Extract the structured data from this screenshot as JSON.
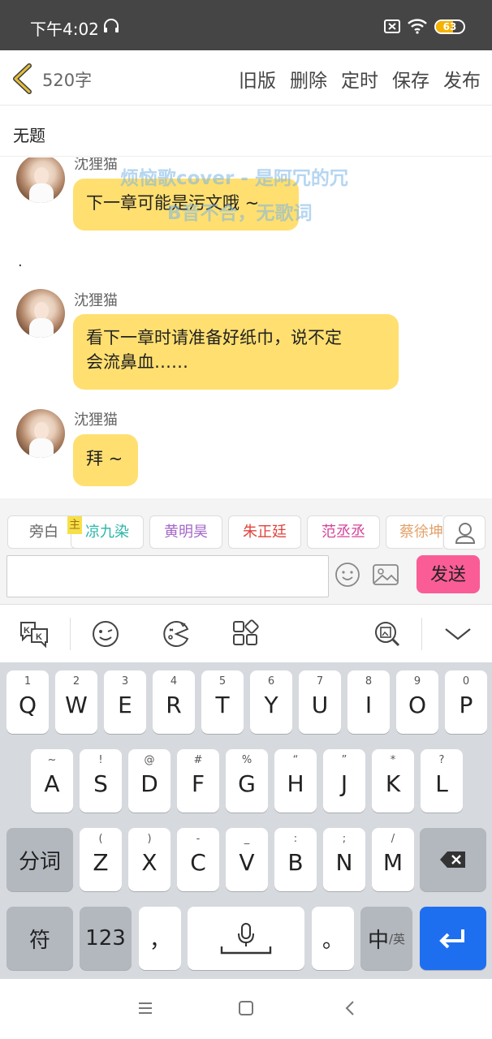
{
  "status_bar": {
    "time": "下午4:02",
    "battery": "63",
    "battery_level": 0.63,
    "icons": [
      "headset-icon",
      "sim-icon",
      "wifi-icon",
      "battery-icon"
    ]
  },
  "toolbar": {
    "word_count": "520字",
    "actions": [
      "旧版",
      "删除",
      "定时",
      "保存",
      "发布"
    ]
  },
  "title": "无题",
  "messages": [
    {
      "sender": "沈狸猫",
      "text": "下一章可能是污文哦 ~"
    },
    {
      "dot": "."
    },
    {
      "sender": "沈狸猫",
      "text_line1": "看下一章时请准备好纸巾，说不定",
      "text_line2": "会流鼻血……"
    },
    {
      "sender": "沈狸猫",
      "text": "拜 ~"
    }
  ],
  "watermark": {
    "line1": "烦恼歌cover - 是阿冗的冗",
    "line2": "B音不合，无歌词"
  },
  "roles": {
    "host_badge": "主",
    "chips": [
      {
        "name": "旁白",
        "color": "#666666"
      },
      {
        "name": "凉九染",
        "color": "#2bb5a8"
      },
      {
        "name": "黄明昊",
        "color": "#a468c8"
      },
      {
        "name": "朱正廷",
        "color": "#e0443e"
      },
      {
        "name": "范丞丞",
        "color": "#d2439a"
      },
      {
        "name": "蔡徐坤",
        "color": "#e3a26a"
      }
    ]
  },
  "input": {
    "value": "",
    "send_label": "发送"
  },
  "keyboard": {
    "row1": [
      {
        "sub": "1",
        "main": "Q"
      },
      {
        "sub": "2",
        "main": "W"
      },
      {
        "sub": "3",
        "main": "E"
      },
      {
        "sub": "4",
        "main": "R"
      },
      {
        "sub": "5",
        "main": "T"
      },
      {
        "sub": "6",
        "main": "Y"
      },
      {
        "sub": "7",
        "main": "U"
      },
      {
        "sub": "8",
        "main": "I"
      },
      {
        "sub": "9",
        "main": "O"
      },
      {
        "sub": "0",
        "main": "P"
      }
    ],
    "row2": [
      {
        "sub": "~",
        "main": "A"
      },
      {
        "sub": "!",
        "main": "S"
      },
      {
        "sub": "@",
        "main": "D"
      },
      {
        "sub": "#",
        "main": "F"
      },
      {
        "sub": "%",
        "main": "G"
      },
      {
        "sub": "“",
        "main": "H"
      },
      {
        "sub": "”",
        "main": "J"
      },
      {
        "sub": "*",
        "main": "K"
      },
      {
        "sub": "?",
        "main": "L"
      }
    ],
    "row3": [
      {
        "sub": "(",
        "main": "Z"
      },
      {
        "sub": ")",
        "main": "X"
      },
      {
        "sub": "-",
        "main": "C"
      },
      {
        "sub": "_",
        "main": "V"
      },
      {
        "sub": ":",
        "main": "B"
      },
      {
        "sub": ";",
        "main": "N"
      },
      {
        "sub": "/",
        "main": "M"
      }
    ],
    "fenci": "分词",
    "fu": "符",
    "num": "123",
    "comma": "，",
    "period": "。",
    "zh": "中",
    "en": "/英"
  }
}
